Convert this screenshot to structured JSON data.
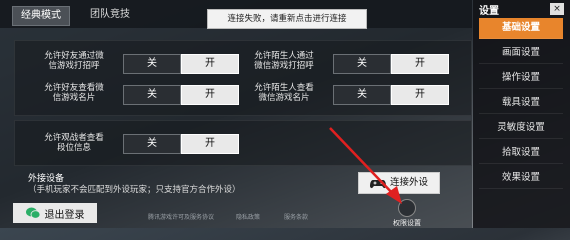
{
  "tabs": {
    "classic": "经典模式",
    "team": "团队竞技"
  },
  "notice": "连接失败，请重新点击进行连接",
  "settings": [
    {
      "label": "允许好友通过微信游戏打招呼",
      "off": "关",
      "on": "开"
    },
    {
      "label": "允许陌生人通过微信游戏打招呼",
      "off": "关",
      "on": "开"
    },
    {
      "label": "允许好友查看微信游戏名片",
      "off": "关",
      "on": "开"
    },
    {
      "label": "允许陌生人查看微信游戏名片",
      "off": "关",
      "on": "开"
    },
    {
      "label": "允许观战者查看段位信息",
      "off": "关",
      "on": "开"
    }
  ],
  "external": {
    "title": "外接设备",
    "subtitle": "（手机玩家不会匹配到外设玩家；只支持官方合作外设）",
    "connect_label": "连接外设"
  },
  "logout_label": "退出登录",
  "footer_links": [
    "腾讯游戏许可及服务协议",
    "隐私政策",
    "服务条款"
  ],
  "permission_label": "权限设置",
  "sidebar": {
    "title": "设置",
    "close": "×",
    "items": [
      "基础设置",
      "画面设置",
      "操作设置",
      "载具设置",
      "灵敏度设置",
      "拾取设置",
      "效果设置"
    ],
    "active_index": 0
  },
  "colors": {
    "accent": "#e8852c",
    "arrow": "#e02020"
  }
}
